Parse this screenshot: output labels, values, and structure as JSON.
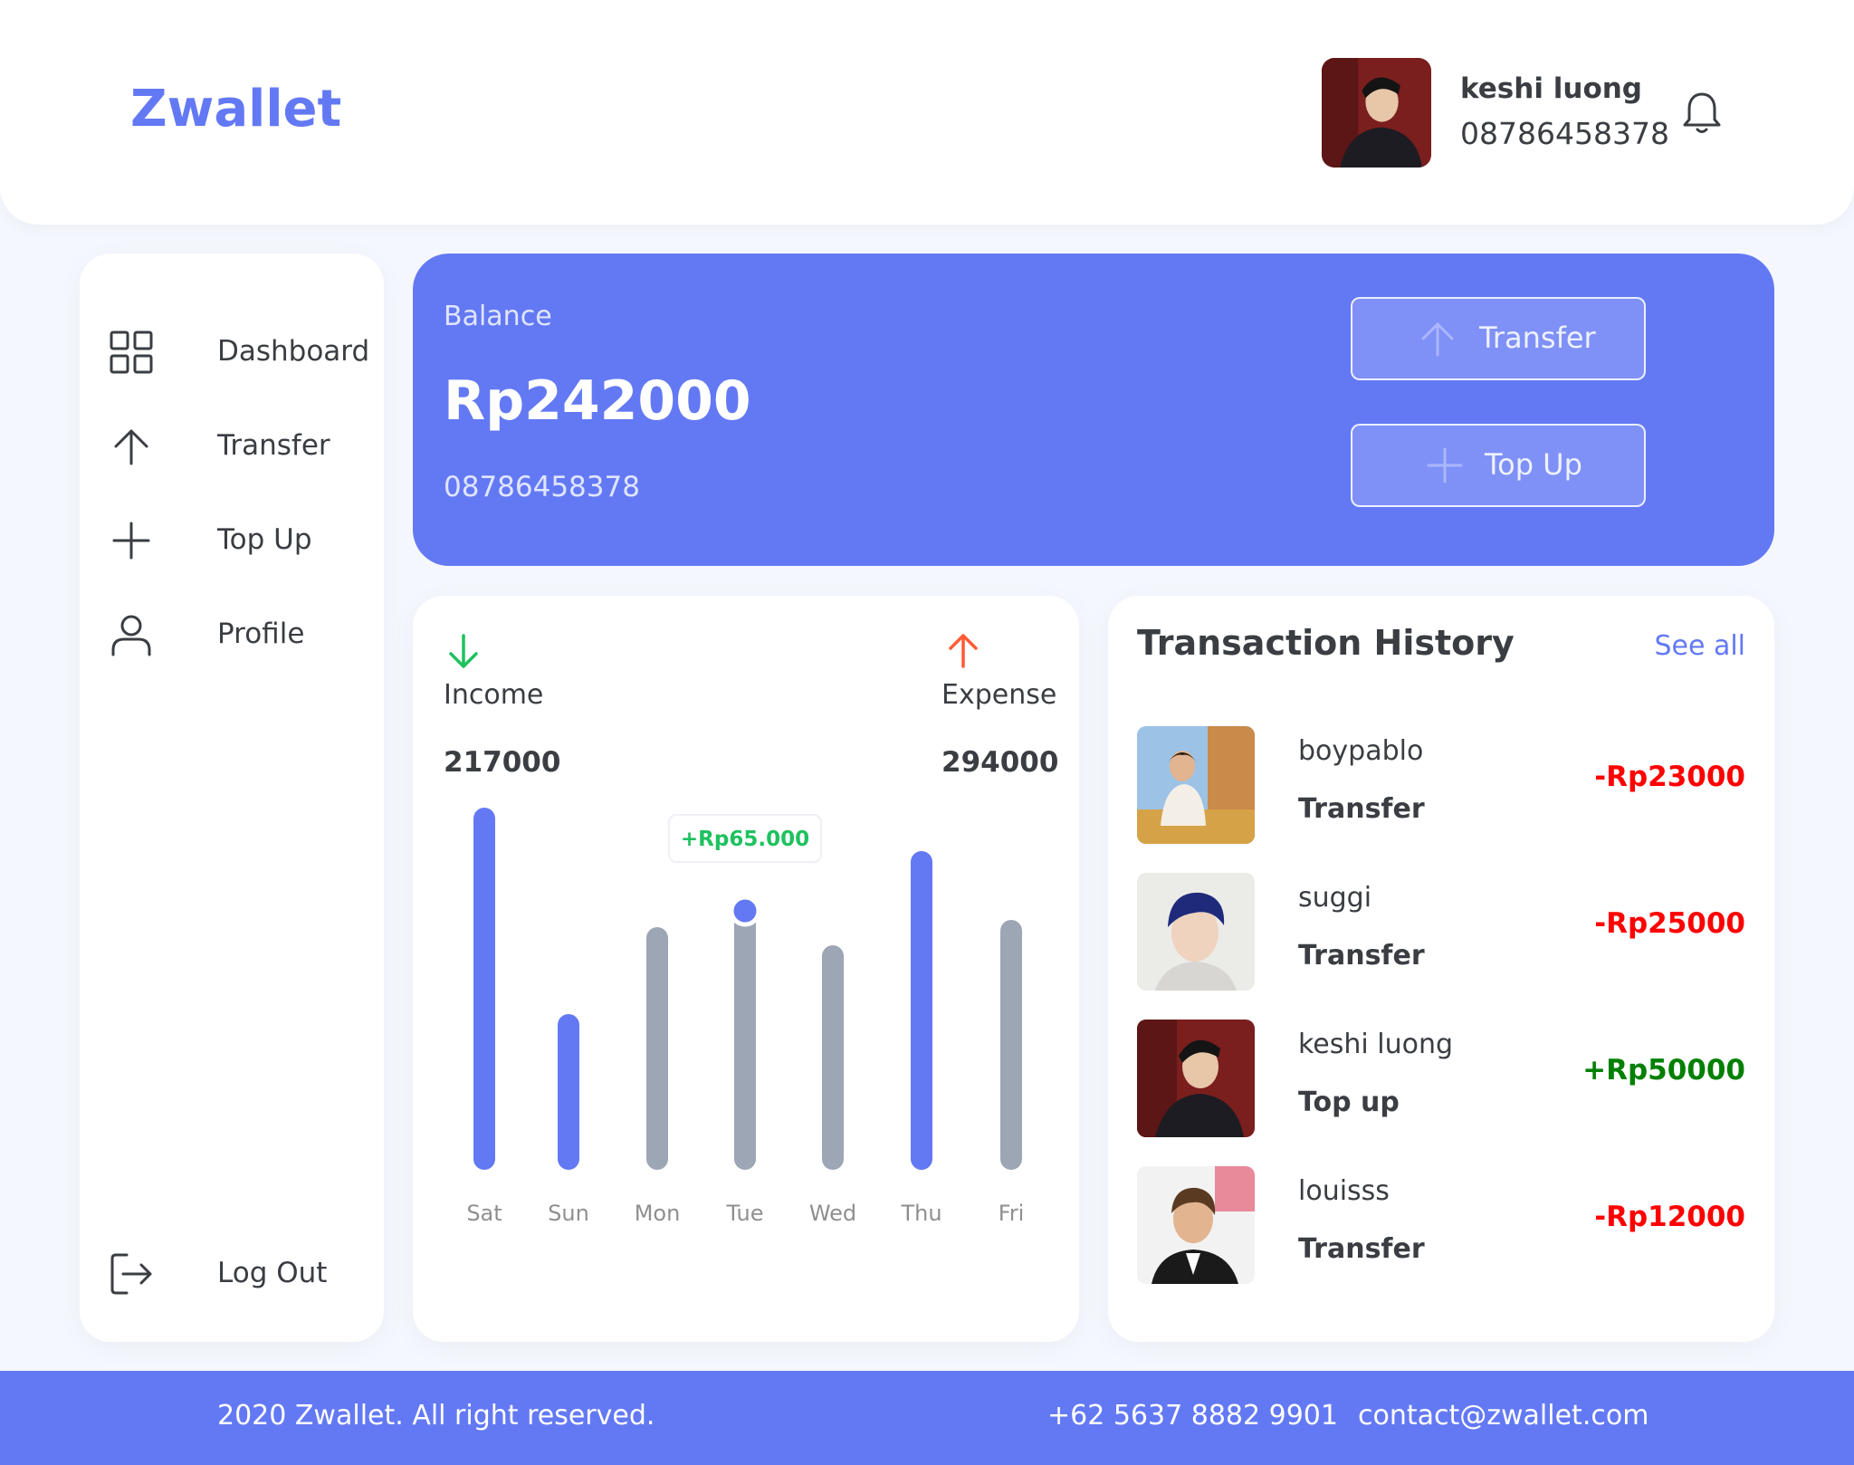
{
  "brand": "Zwallet",
  "colors": {
    "primary": "#6379f4",
    "income": "#1ec15f",
    "expense": "#ff5b37",
    "negative": "#ff0000",
    "positive": "#008000",
    "bar_muted": "#9da6b5"
  },
  "user": {
    "name": "keshi luong",
    "phone": "08786458378",
    "avatar_icon": "user-avatar-photo"
  },
  "header": {
    "notification_icon": "bell-icon"
  },
  "sidebar": {
    "items": [
      {
        "label": "Dashboard",
        "icon": "grid-icon"
      },
      {
        "label": "Transfer",
        "icon": "arrow-up-icon"
      },
      {
        "label": "Top Up",
        "icon": "plus-icon"
      },
      {
        "label": "Profile",
        "icon": "user-icon"
      }
    ],
    "logout": {
      "label": "Log Out",
      "icon": "logout-icon"
    }
  },
  "balance": {
    "label": "Balance",
    "amount": "Rp242000",
    "phone": "08786458378",
    "transfer_label": "Transfer",
    "topup_label": "Top Up"
  },
  "summary": {
    "income_label": "Income",
    "income_value": "217000",
    "expense_label": "Expense",
    "expense_value": "294000"
  },
  "chart_data": {
    "type": "bar",
    "categories": [
      "Sat",
      "Sun",
      "Mon",
      "Tue",
      "Wed",
      "Thu",
      "Fri"
    ],
    "values": [
      100,
      43,
      67,
      74,
      62,
      88,
      69
    ],
    "highlight": [
      true,
      true,
      false,
      false,
      false,
      true,
      false
    ],
    "tooltip": {
      "category": "Tue",
      "text": "+Rp65.000"
    },
    "ylim": [
      0,
      100
    ]
  },
  "history": {
    "title": "Transaction History",
    "see_all": "See all",
    "rows": [
      {
        "name": "boypablo",
        "type": "Transfer",
        "amount": "-Rp23000",
        "sign": "negative"
      },
      {
        "name": "suggi",
        "type": "Transfer",
        "amount": "-Rp25000",
        "sign": "negative"
      },
      {
        "name": "keshi luong",
        "type": "Top up",
        "amount": "+Rp50000",
        "sign": "positive"
      },
      {
        "name": "louisss",
        "type": "Transfer",
        "amount": "-Rp12000",
        "sign": "negative"
      }
    ]
  },
  "footer": {
    "copyright": "2020 Zwallet. All right reserved.",
    "phone": "+62 5637 8882 9901",
    "email": "contact@zwallet.com"
  }
}
